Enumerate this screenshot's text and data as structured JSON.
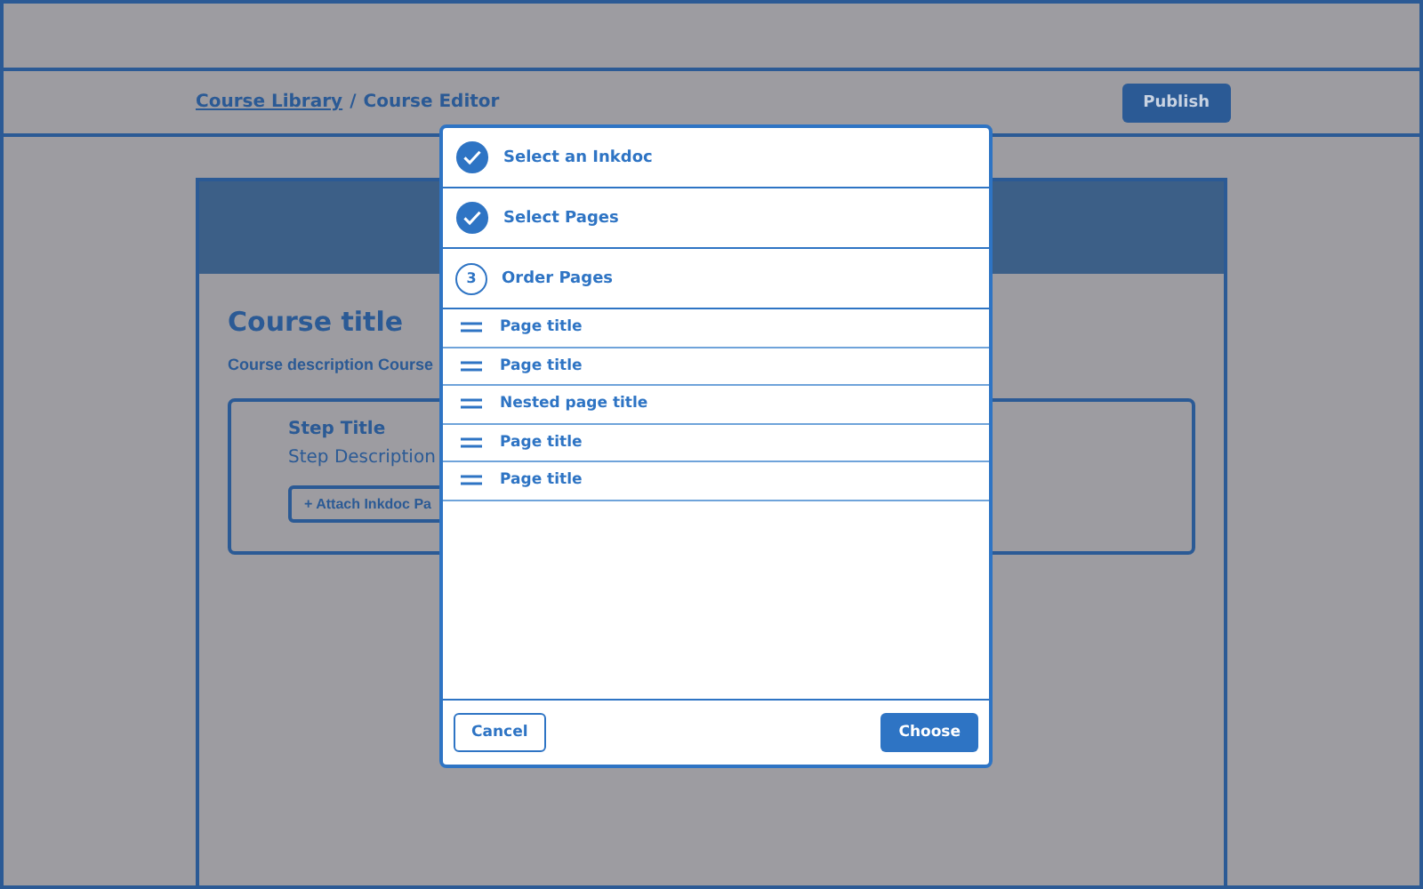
{
  "header": {
    "breadcrumb_link": "Course Library",
    "breadcrumb_separator": "/",
    "breadcrumb_current": "Course Editor",
    "publish_button": "Publish"
  },
  "course": {
    "title": "Course title",
    "description": "Course description Course",
    "step": {
      "title": "Step Title",
      "description": "Step Description",
      "attach_button": "+ Attach Inkdoc Pa"
    }
  },
  "modal": {
    "steps": [
      {
        "label": "Select an Inkdoc",
        "completed": true
      },
      {
        "label": "Select Pages",
        "completed": true
      },
      {
        "label": "Order Pages",
        "completed": false,
        "number": "3"
      }
    ],
    "pages": [
      {
        "title": "Page title"
      },
      {
        "title": "Page title"
      },
      {
        "title": "Nested page title"
      },
      {
        "title": "Page title"
      },
      {
        "title": "Page title"
      }
    ],
    "cancel_button": "Cancel",
    "choose_button": "Choose"
  }
}
